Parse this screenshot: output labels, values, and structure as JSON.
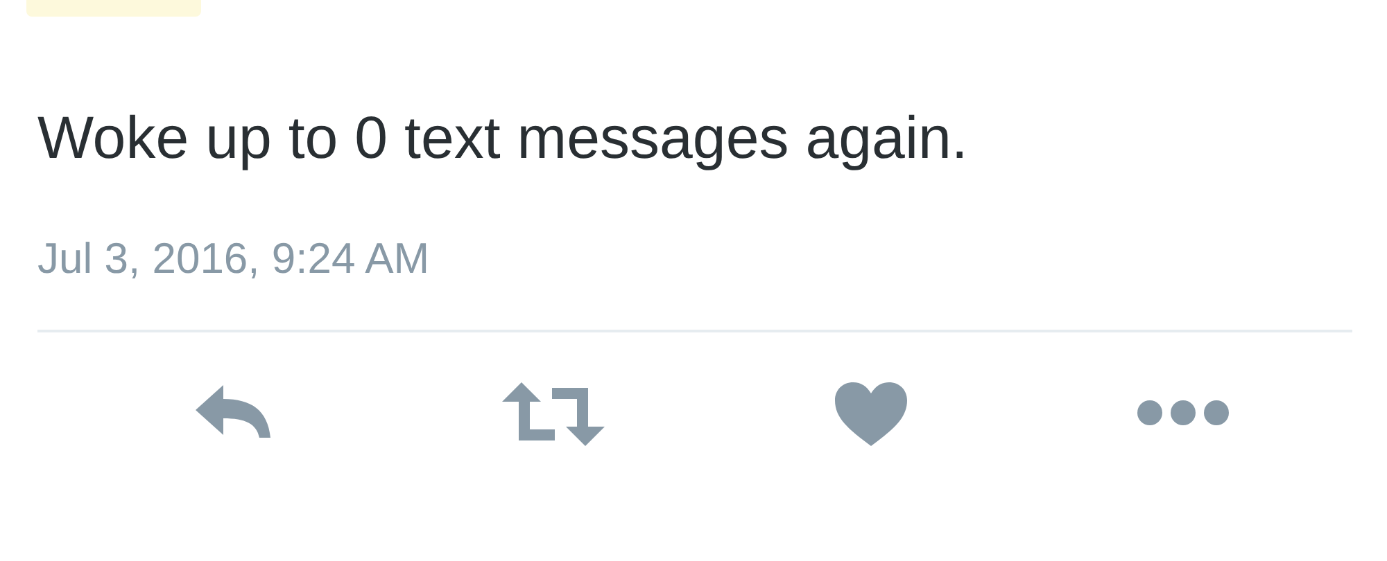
{
  "tweet": {
    "text": "Woke up to 0 text messages again.",
    "timestamp": "Jul 3, 2016, 9:24 AM"
  },
  "actions": [
    {
      "kind": "reply"
    },
    {
      "kind": "retweet"
    },
    {
      "kind": "like"
    },
    {
      "kind": "more"
    }
  ]
}
